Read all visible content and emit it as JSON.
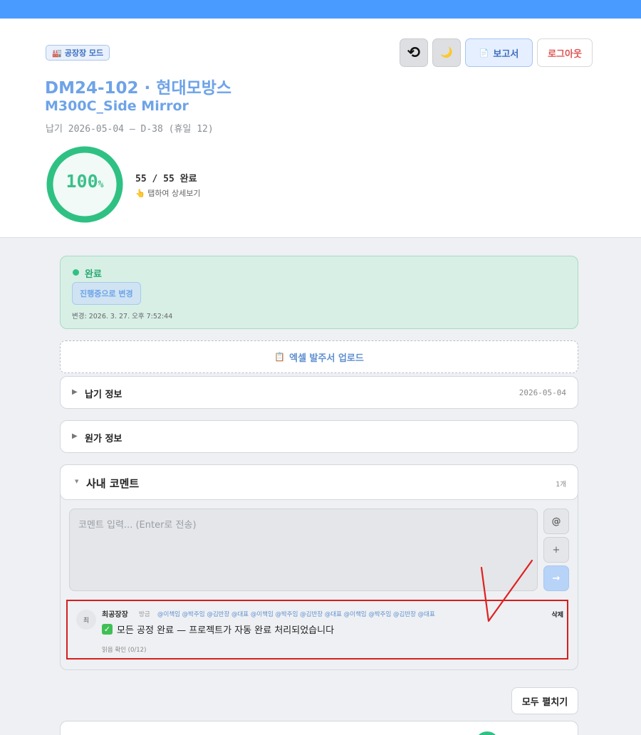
{
  "header": {
    "mode_badge_icon": "factory-icon",
    "mode_badge": "공장장 모드",
    "title": "DM24-102 · 현대모방스",
    "subtitle": "M300C_Side Mirror",
    "due_line": "납기 2026-05-04 — D-38 (휴일 12)",
    "progress_percent": 100,
    "progress_number": "100",
    "progress_unit": "%",
    "done_count": "55 / 55 완료",
    "tap_hint": "👆 탭하여 상세보기",
    "buttons": {
      "undo_icon": "undo-icon",
      "undo_glyph": "⟲",
      "dark_icon": "moon-icon",
      "dark_glyph": "🌙",
      "report_icon": "document-icon",
      "report_glyph": "📄",
      "report_label": "보고서",
      "logout_label": "로그아웃"
    },
    "colors": {
      "accent": "#4a9bff",
      "progress": "#2fc183",
      "logout": "#e05555"
    }
  },
  "status": {
    "label": "완료",
    "change_button": "진행중으로 변경",
    "changed_at": "변경: 2026. 3. 27. 오후 7:52:44"
  },
  "upload": {
    "icon": "clipboard-icon",
    "glyph": "📋",
    "label": "엑셀 발주서 업로드"
  },
  "panels": [
    {
      "title": "납기 정보",
      "right": "2026-05-04",
      "expanded": false
    },
    {
      "title": "원가 정보",
      "right": "",
      "expanded": false
    }
  ],
  "comments": {
    "title": "사내 코멘트",
    "count": "1개",
    "input_placeholder": "코멘트 입력... (Enter로 전송)",
    "mention_button": "@",
    "attach_button": "+",
    "send_button": "→",
    "items": [
      {
        "avatar": "최",
        "author": "최공장장",
        "time": "방금",
        "mentions": "@이책임 @박주임 @김반장 @대표 @이책임 @박주임 @김반장 @대표 @이책임 @박주임 @김반장 @대표",
        "delete_label": "삭제",
        "check_glyph": "✓",
        "text": "모든 공정 완료 — 프로젝트가 자동 완료 처리되었습니다",
        "read_status": "읽음 확인 (0/12)"
      }
    ]
  },
  "expand_all": "모두 펼치기"
}
